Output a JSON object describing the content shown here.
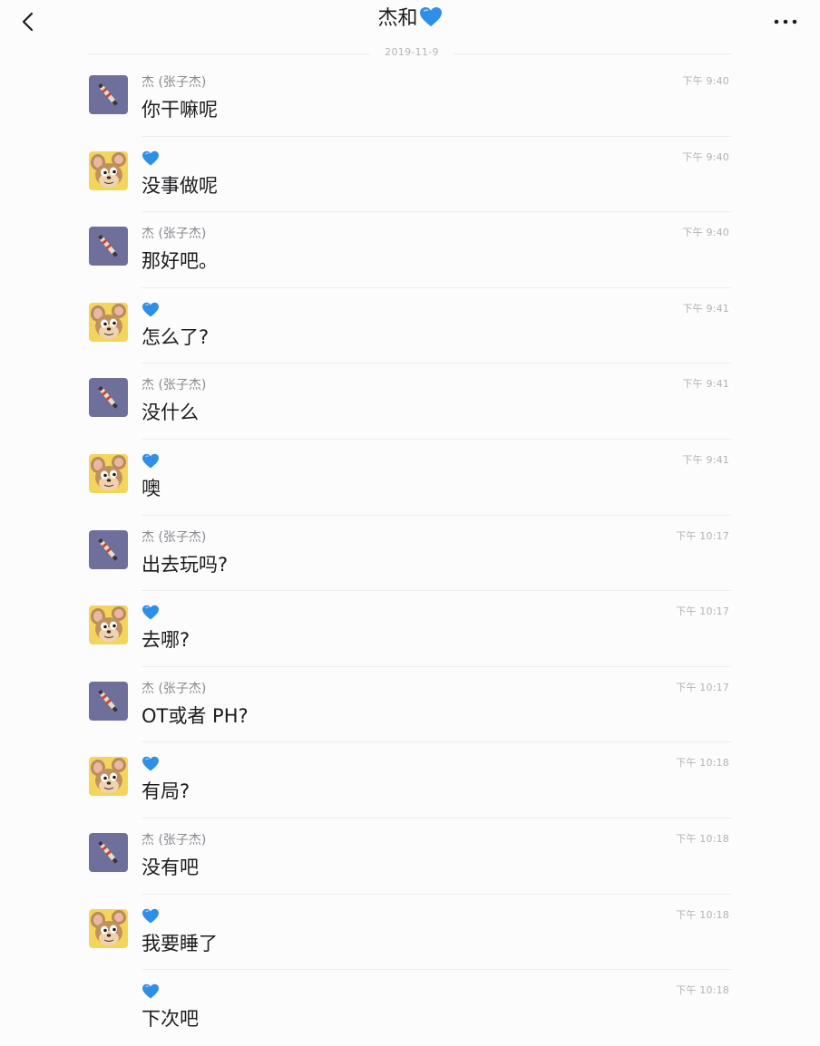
{
  "header": {
    "title": "杰和",
    "title_icon": "blue-heart-icon",
    "back_icon": "chevron-left-icon",
    "more_icon": "more-dots-icon"
  },
  "date_separator": "2019-11-9",
  "colors": {
    "heart": "#2f8fe6",
    "avatar_purple": "#6f6f9c",
    "avatar_yellow": "#f4d55c"
  },
  "messages": [
    {
      "sender": "杰 (张子杰)",
      "avatar": "purple-avatar",
      "time": "下午 9:40",
      "text": "你干嘛呢"
    },
    {
      "sender": "",
      "avatar": "jerry-avatar",
      "time": "下午 9:40",
      "text": "没事做呢"
    },
    {
      "sender": "杰 (张子杰)",
      "avatar": "purple-avatar",
      "time": "下午 9:40",
      "text": "那好吧。"
    },
    {
      "sender": "",
      "avatar": "jerry-avatar",
      "time": "下午 9:41",
      "text": "怎么了?"
    },
    {
      "sender": "杰 (张子杰)",
      "avatar": "purple-avatar",
      "time": "下午 9:41",
      "text": "没什么"
    },
    {
      "sender": "",
      "avatar": "jerry-avatar",
      "time": "下午 9:41",
      "text": "噢"
    },
    {
      "sender": "杰 (张子杰)",
      "avatar": "purple-avatar",
      "time": "下午 10:17",
      "text": "出去玩吗?"
    },
    {
      "sender": "",
      "avatar": "jerry-avatar",
      "time": "下午 10:17",
      "text": "去哪?"
    },
    {
      "sender": "杰 (张子杰)",
      "avatar": "purple-avatar",
      "time": "下午 10:17",
      "text": "OT或者 PH?"
    },
    {
      "sender": "",
      "avatar": "jerry-avatar",
      "time": "下午 10:18",
      "text": "有局?"
    },
    {
      "sender": "杰 (张子杰)",
      "avatar": "purple-avatar",
      "time": "下午 10:18",
      "text": "没有吧"
    },
    {
      "sender": "",
      "avatar": "jerry-avatar",
      "time": "下午 10:18",
      "text": "我要睡了"
    },
    {
      "sender": "",
      "avatar": "",
      "time": "下午 10:18",
      "text": "下次吧"
    }
  ]
}
